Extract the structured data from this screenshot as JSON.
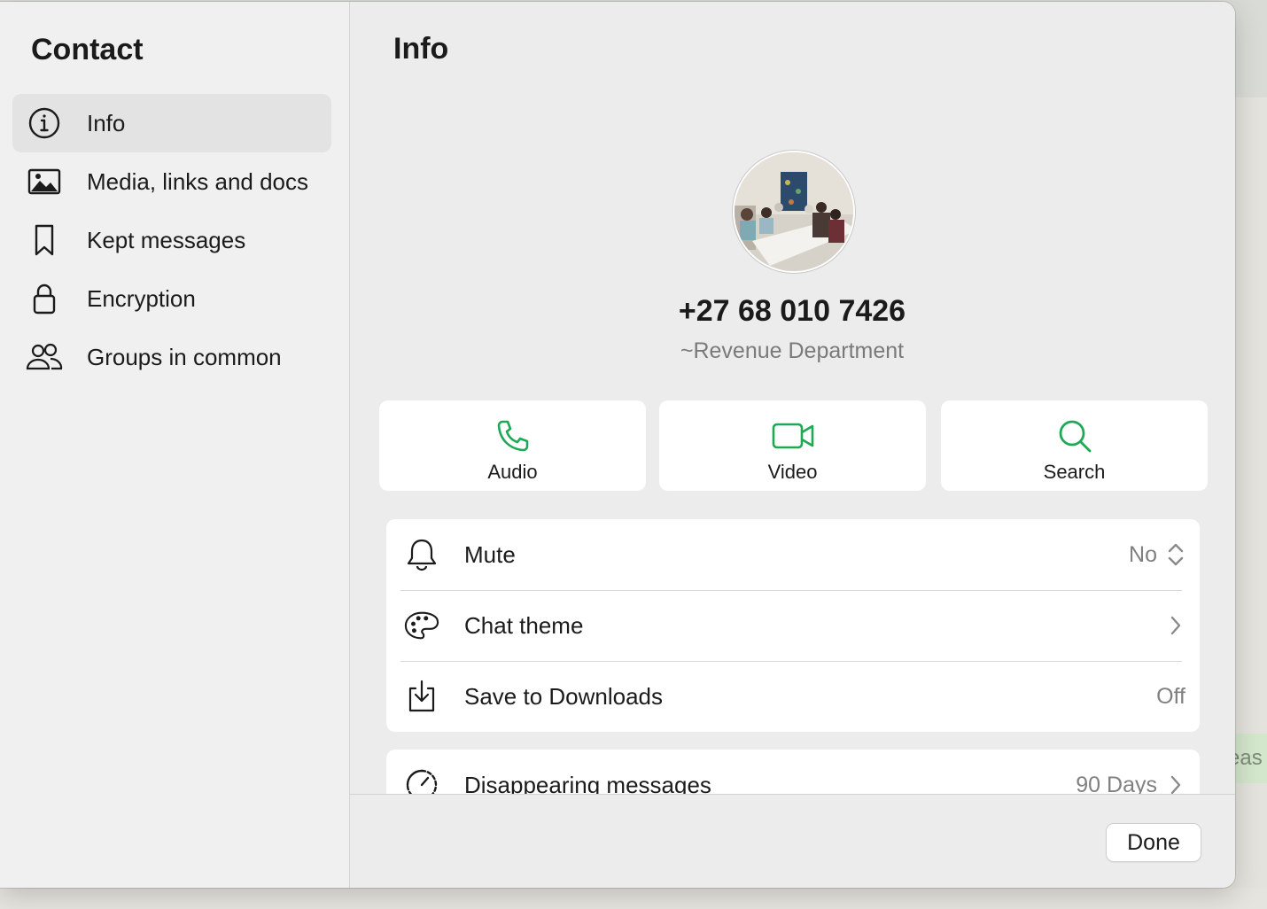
{
  "background": {
    "bubble_text": "eas"
  },
  "sidebar": {
    "title": "Contact",
    "items": [
      {
        "label": "Info",
        "icon": "info-icon",
        "active": true
      },
      {
        "label": "Media, links and docs",
        "icon": "image-icon",
        "active": false
      },
      {
        "label": "Kept messages",
        "icon": "bookmark-icon",
        "active": false
      },
      {
        "label": "Encryption",
        "icon": "lock-icon",
        "active": false
      },
      {
        "label": "Groups in common",
        "icon": "people-icon",
        "active": false
      }
    ]
  },
  "main": {
    "title": "Info",
    "contact": {
      "phone": "+27 68 010 7426",
      "name": "~Revenue Department"
    },
    "actions": [
      {
        "label": "Audio",
        "icon": "phone-icon"
      },
      {
        "label": "Video",
        "icon": "video-camera-icon"
      },
      {
        "label": "Search",
        "icon": "search-icon"
      }
    ],
    "settings": {
      "mute": {
        "label": "Mute",
        "value": "No",
        "icon": "bell-icon"
      },
      "chat_theme": {
        "label": "Chat theme",
        "icon": "palette-icon"
      },
      "save_to_downloads": {
        "label": "Save to Downloads",
        "value": "Off",
        "icon": "download-icon"
      }
    },
    "disappearing": {
      "label": "Disappearing messages",
      "value": "90 Days",
      "icon": "timer-icon"
    }
  },
  "footer": {
    "done_label": "Done"
  },
  "colors": {
    "accent": "#1fa855",
    "text": "#1b1b1b",
    "secondary": "#808080"
  }
}
